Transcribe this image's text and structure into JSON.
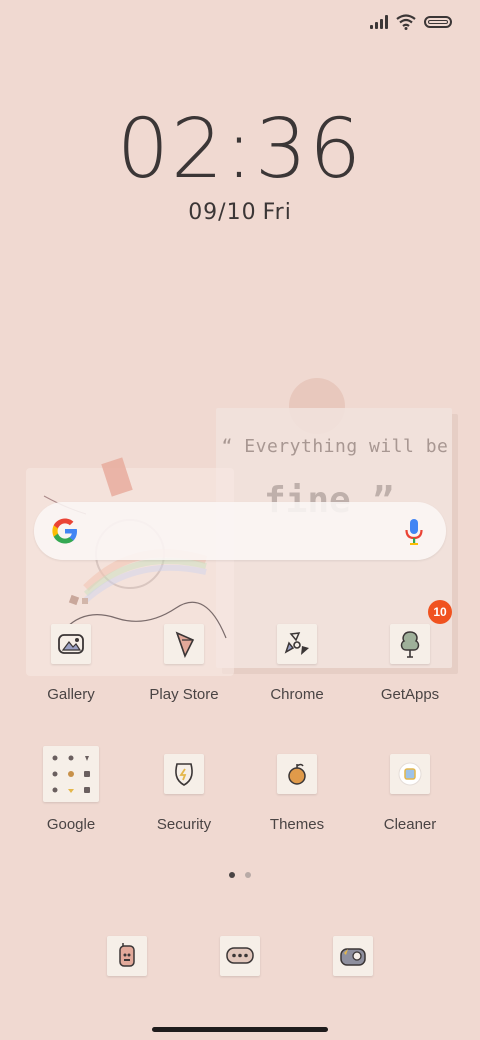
{
  "status": {
    "signal": "signal-icon",
    "wifi": "wifi-icon",
    "battery": "battery-icon"
  },
  "clock": {
    "time": "02:36",
    "date": "09/10",
    "day": "Fri"
  },
  "widget": {
    "quote_line1": "“ Everything will be",
    "quote_line2": "fine ”"
  },
  "search": {
    "logo": "google-logo-icon",
    "mic": "mic-icon"
  },
  "apps_row1": [
    {
      "label": "Gallery",
      "icon": "gallery-icon"
    },
    {
      "label": "Play Store",
      "icon": "play-store-icon"
    },
    {
      "label": "Chrome",
      "icon": "chrome-icon"
    },
    {
      "label": "GetApps",
      "icon": "getapps-icon",
      "badge": "10"
    }
  ],
  "apps_row2": [
    {
      "label": "Google",
      "icon": "google-folder-icon"
    },
    {
      "label": "Security",
      "icon": "security-icon"
    },
    {
      "label": "Themes",
      "icon": "themes-icon"
    },
    {
      "label": "Cleaner",
      "icon": "cleaner-icon"
    }
  ],
  "dock": [
    {
      "icon": "phone-icon"
    },
    {
      "icon": "messages-icon"
    },
    {
      "icon": "camera-icon"
    }
  ],
  "colors": {
    "background": "#f0d9d1",
    "badge": "#f0521f",
    "text": "#3b3636"
  }
}
